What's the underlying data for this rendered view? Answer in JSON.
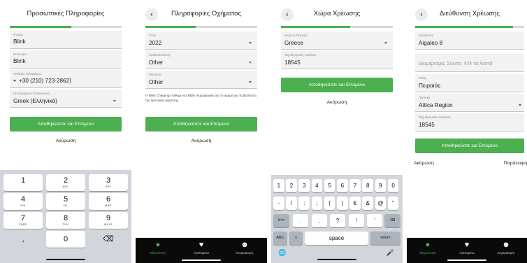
{
  "colors": {
    "accent": "#4caf50",
    "field_bg": "#f2f2f2",
    "tabbar_bg": "#0a0a0a"
  },
  "screen1": {
    "title": "Προσωπικές Πληροφορίες",
    "progress": 0.55,
    "name_label": "Όνομα",
    "name_value": "Blink",
    "surname_label": "Επώνυμο",
    "surname_value": "Blink",
    "phone_label": "Αριθμός Τηλεφώνου",
    "phone_value": "+30  (210) 723-2862",
    "language_label": "Προτιμώμενη Επικοινωνία",
    "language_value": "Greek (Ελληνικά)",
    "primary_button": "Αποθηκεύστε και Επόμενο",
    "cancel": "Ακύρωση",
    "keypad": [
      {
        "digit": "1",
        "letters": ""
      },
      {
        "digit": "2",
        "letters": "ABC"
      },
      {
        "digit": "3",
        "letters": "DEF"
      },
      {
        "digit": "4",
        "letters": "GHI"
      },
      {
        "digit": "5",
        "letters": "JKL"
      },
      {
        "digit": "6",
        "letters": "MNO"
      },
      {
        "digit": "7",
        "letters": "PQRS"
      },
      {
        "digit": "8",
        "letters": "TUV"
      },
      {
        "digit": "9",
        "letters": "WXYZ"
      },
      {
        "digit": ",",
        "letters": ""
      },
      {
        "digit": "0",
        "letters": ""
      },
      {
        "digit": "⌫",
        "letters": ""
      }
    ]
  },
  "screen2": {
    "title": "Πληροφορίες Οχήματος",
    "back_icon": "chevron-left-icon",
    "progress": 0.45,
    "year_label": "Έτος",
    "year_value": "2022",
    "make_label": "Κατασκευαστής",
    "make_value": "Other",
    "model_label": "Μοντέλο",
    "model_value": "Other",
    "note": "Η Blink Charging επιθυμεί να λάβει πληροφορίες για το όχημα για τη βελτίωση της εμπειρίας φόρτισης.",
    "primary_button": "Αποθηκεύστε και Επόμενο",
    "cancel": "Ακύρωση"
  },
  "screen3": {
    "title": "Χώρα Χρέωσης",
    "back_icon": "chevron-left-icon",
    "progress": 0.62,
    "country_label": "Χώρα ή Περιοχή",
    "country_value": "Greece",
    "postal_label": "Ταχυδρομικός Κώδικας",
    "postal_value": "18545",
    "primary_button": "Αποθηκεύστε και Επόμενο",
    "cancel": "Ακύρωση",
    "keyboard": {
      "row1": [
        "1",
        "2",
        "3",
        "4",
        "5",
        "6",
        "7",
        "8",
        "9",
        "0"
      ],
      "row2": [
        "-",
        "/",
        ":",
        ";",
        "(",
        ")",
        "€",
        "&",
        "@",
        "\""
      ],
      "row3_left": "#+=",
      "row3": [
        ".",
        ",",
        "?",
        "!",
        "’"
      ],
      "row3_right": "⌫",
      "abc": "ABC",
      "emoji": "☺",
      "space": "space",
      "return": "return",
      "globe": "🌐",
      "mic": "🎤"
    }
  },
  "screen4": {
    "title": "Διεύθυνση Χρέωσης",
    "back_icon": "chevron-left-icon",
    "progress": 0.9,
    "address_label": "Διεύθυνση",
    "address_value": "Aigaleo 8",
    "address2_placeholder": "Διαμέρισμα, Σουίτα, Κτλ τα λοιπά",
    "city_label": "Πόλη",
    "city_value": "Πειραιάς",
    "region_label": "Περιοχή",
    "region_value": "Attica Region",
    "postal_label": "Ταχυδρομικός Κώδικας",
    "postal_value": "18545",
    "primary_button": "Αποθηκεύστε και Επόμενο",
    "cancel": "Ακύρωση",
    "skip": "Παράλειψη"
  },
  "tabbar": [
    {
      "label": "Εξερεύνηση",
      "icon": "location-pin-icon",
      "glyph": "⬤"
    },
    {
      "label": "Αγαπημένα",
      "icon": "heart-icon",
      "glyph": "♥"
    },
    {
      "label": "Λογαριασμός",
      "icon": "account-icon",
      "glyph": "☻"
    }
  ]
}
